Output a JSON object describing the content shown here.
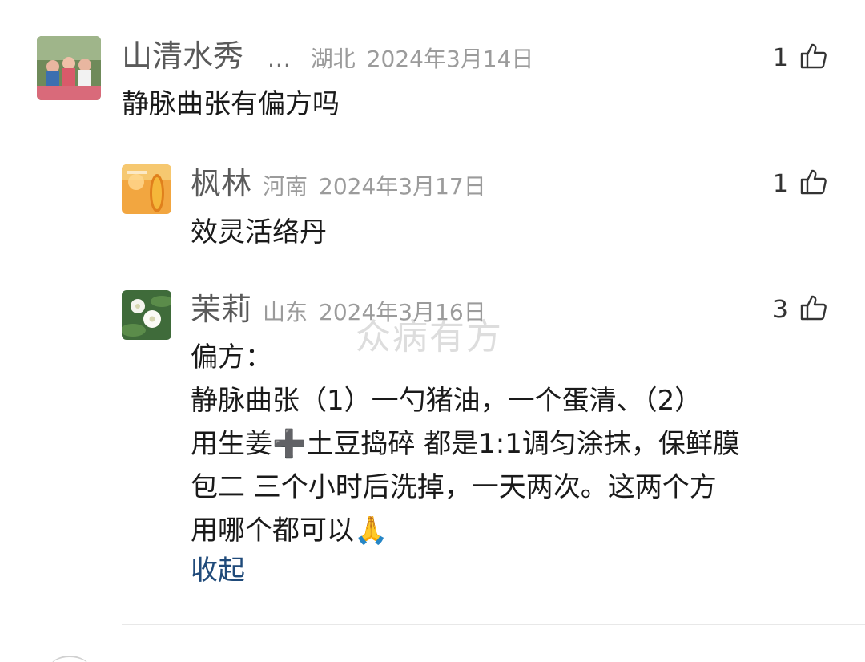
{
  "comments": [
    {
      "name": "山清水秀",
      "ellipsis": "...",
      "location": "湖北",
      "date": "2024年3月14日",
      "likes": "1",
      "body": "静脉曲张有偏方吗"
    },
    {
      "name": "枫林",
      "location": "河南",
      "date": "2024年3月17日",
      "likes": "1",
      "body": "效灵活络丹"
    },
    {
      "name": "茉莉",
      "location": "山东",
      "date": "2024年3月16日",
      "likes": "3",
      "body_lines": [
        "偏方：",
        "静脉曲张（1）一勺猪油，一个蛋清、（2）",
        "用生姜➕土豆捣碎 都是1:1调匀涂抹，保鲜膜",
        "包二 三个小时后洗掉，一天两次。这两个方",
        "用哪个都可以🙏"
      ],
      "collapse_label": "收起"
    }
  ],
  "watermark": "众病有方",
  "icons": {
    "like": "thumbs-up-icon"
  }
}
